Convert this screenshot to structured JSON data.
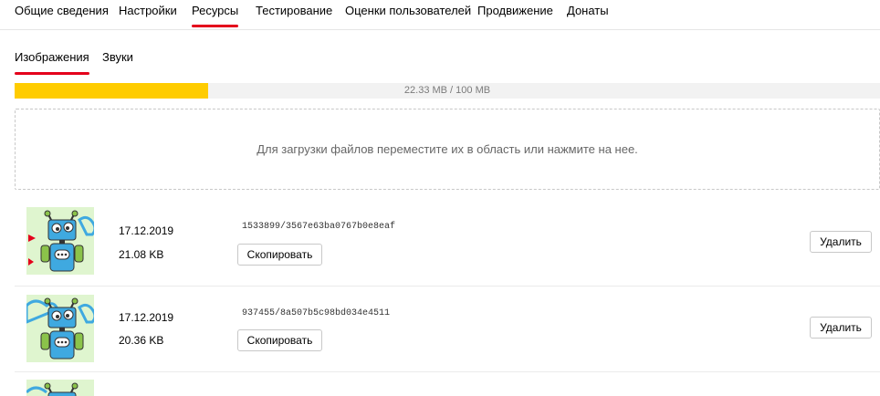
{
  "top_tabs": [
    "Общие сведения",
    "Настройки",
    "Ресурсы",
    "Тестирование",
    "Оценки пользователей",
    "Продвижение",
    "Донаты"
  ],
  "sub_tabs": [
    "Изображения",
    "Звуки"
  ],
  "storage": {
    "label": "22.33 MB / 100 MB",
    "used_mb": 22.33,
    "total_mb": 100
  },
  "dropzone": {
    "message": "Для загрузки файлов переместите их в область или нажмите на нее."
  },
  "buttons": {
    "copy": "Скопировать",
    "delete": "Удалить"
  },
  "files": [
    {
      "date": "17.12.2019",
      "size": "21.08 KB",
      "path": "1533899/3567e63ba0767b0e8eaf"
    },
    {
      "date": "17.12.2019",
      "size": "20.36 KB",
      "path": "937455/8a507b5c98bd034e4511"
    }
  ],
  "colors": {
    "accent": "#e4001b",
    "progress": "#ffcc00"
  }
}
